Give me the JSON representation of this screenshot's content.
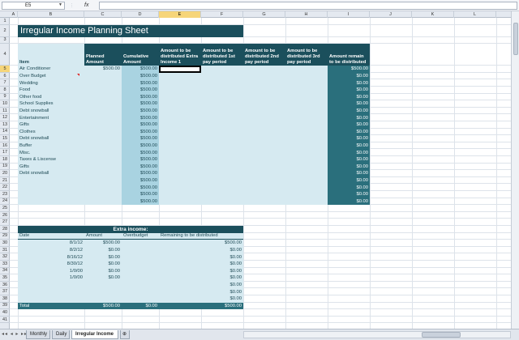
{
  "name_box": "E5",
  "formula_bar": {
    "fx": "fx",
    "value": ""
  },
  "columns": [
    "A",
    "B",
    "C",
    "D",
    "E",
    "F",
    "G",
    "H",
    "I",
    "J",
    "K",
    "L",
    "M"
  ],
  "selected_column": "E",
  "selected_row": "5",
  "rows": [
    "1",
    "2",
    "3",
    "4",
    "5",
    "6",
    "7",
    "8",
    "9",
    "10",
    "11",
    "12",
    "13",
    "14",
    "15",
    "16",
    "17",
    "18",
    "19",
    "20",
    "21",
    "22",
    "23",
    "24",
    "25",
    "26",
    "27",
    "28",
    "29",
    "30",
    "31",
    "32",
    "33",
    "34",
    "35",
    "36",
    "37",
    "38",
    "39",
    "40",
    "41"
  ],
  "title": "Irregular Income Planning Sheet",
  "table1": {
    "headers": {
      "item": "Item",
      "planned": "Planned Amount",
      "cumulative": "Cumulative Amount",
      "extra1": "Amount to be distributed Extra Income 1",
      "first": "Amount  to be distributed 1st pay period",
      "second": "Amount to be distributed 2nd pay period",
      "third": "Amount to be distributed 3rd pay period",
      "remain": "Amount remain to be distributed"
    },
    "rows": [
      {
        "item": "Air Conditioner",
        "planned": "$500.00",
        "cumulative": "$500.00",
        "remain": "$500.00"
      },
      {
        "item": "Over Budget",
        "planned": "",
        "cumulative": "$500.00",
        "remain": "$0.00"
      },
      {
        "item": "Wedding",
        "planned": "",
        "cumulative": "$500.00",
        "remain": "$0.00"
      },
      {
        "item": "Food",
        "planned": "",
        "cumulative": "$500.00",
        "remain": "$0.00"
      },
      {
        "item": "Other food",
        "planned": "",
        "cumulative": "$500.00",
        "remain": "$0.00"
      },
      {
        "item": "School Supplies",
        "planned": "",
        "cumulative": "$500.00",
        "remain": "$0.00"
      },
      {
        "item": "Debt snowball",
        "planned": "",
        "cumulative": "$500.00",
        "remain": "$0.00"
      },
      {
        "item": "Entertainment",
        "planned": "",
        "cumulative": "$500.00",
        "remain": "$0.00"
      },
      {
        "item": "Gifts",
        "planned": "",
        "cumulative": "$500.00",
        "remain": "$0.00"
      },
      {
        "item": "Clothes",
        "planned": "",
        "cumulative": "$500.00",
        "remain": "$0.00"
      },
      {
        "item": "Debt snowball",
        "planned": "",
        "cumulative": "$500.00",
        "remain": "$0.00"
      },
      {
        "item": "Buffer",
        "planned": "",
        "cumulative": "$500.00",
        "remain": "$0.00"
      },
      {
        "item": "Misc.",
        "planned": "",
        "cumulative": "$500.00",
        "remain": "$0.00"
      },
      {
        "item": "Taxes & Liscense",
        "planned": "",
        "cumulative": "$500.00",
        "remain": "$0.00"
      },
      {
        "item": "Gifts",
        "planned": "",
        "cumulative": "$500.00",
        "remain": "$0.00"
      },
      {
        "item": "Debt snowball",
        "planned": "",
        "cumulative": "$500.00",
        "remain": "$0.00"
      },
      {
        "item": "",
        "planned": "",
        "cumulative": "$500.00",
        "remain": "$0.00"
      },
      {
        "item": "",
        "planned": "",
        "cumulative": "$500.00",
        "remain": "$0.00"
      },
      {
        "item": "",
        "planned": "",
        "cumulative": "$500.00",
        "remain": "$0.00"
      },
      {
        "item": "",
        "planned": "",
        "cumulative": "$500.00",
        "remain": "$0.00"
      }
    ]
  },
  "table2": {
    "title": "Extra income:",
    "headers": {
      "date": "Date",
      "amount": "Amount",
      "overbudget": "Overbudget",
      "remaining": "Remaining to be distributed"
    },
    "rows": [
      {
        "date": "8/1/12",
        "amount": "$500.00",
        "overbudget": "",
        "remaining": "$500.00"
      },
      {
        "date": "8/2/12",
        "amount": "$0.00",
        "overbudget": "",
        "remaining": "$0.00"
      },
      {
        "date": "8/16/12",
        "amount": "$0.00",
        "overbudget": "",
        "remaining": "$0.00"
      },
      {
        "date": "8/30/12",
        "amount": "$0.00",
        "overbudget": "",
        "remaining": "$0.00"
      },
      {
        "date": "1/0/00",
        "amount": "$0.00",
        "overbudget": "",
        "remaining": "$0.00"
      },
      {
        "date": "1/0/00",
        "amount": "$0.00",
        "overbudget": "",
        "remaining": "$0.00"
      },
      {
        "date": "",
        "amount": "",
        "overbudget": "",
        "remaining": "$0.00"
      },
      {
        "date": "",
        "amount": "",
        "overbudget": "",
        "remaining": "$0.00"
      },
      {
        "date": "",
        "amount": "",
        "overbudget": "",
        "remaining": "$0.00"
      }
    ],
    "total": {
      "label": "Total",
      "amount": "$500.00",
      "overbudget": "$0.00",
      "remaining": "$500.00"
    }
  },
  "sheet_tabs": [
    "Monthly",
    "Daily",
    "Irregular Income"
  ],
  "active_tab": "Irregular Income",
  "tab_nav": "◂◂ ◂ ▸ ▸▸",
  "colors": {
    "dark": "#1b4f5c",
    "mid": "#2a6f7c",
    "light": "#d6eaf1",
    "selected": "#f6d57a"
  }
}
